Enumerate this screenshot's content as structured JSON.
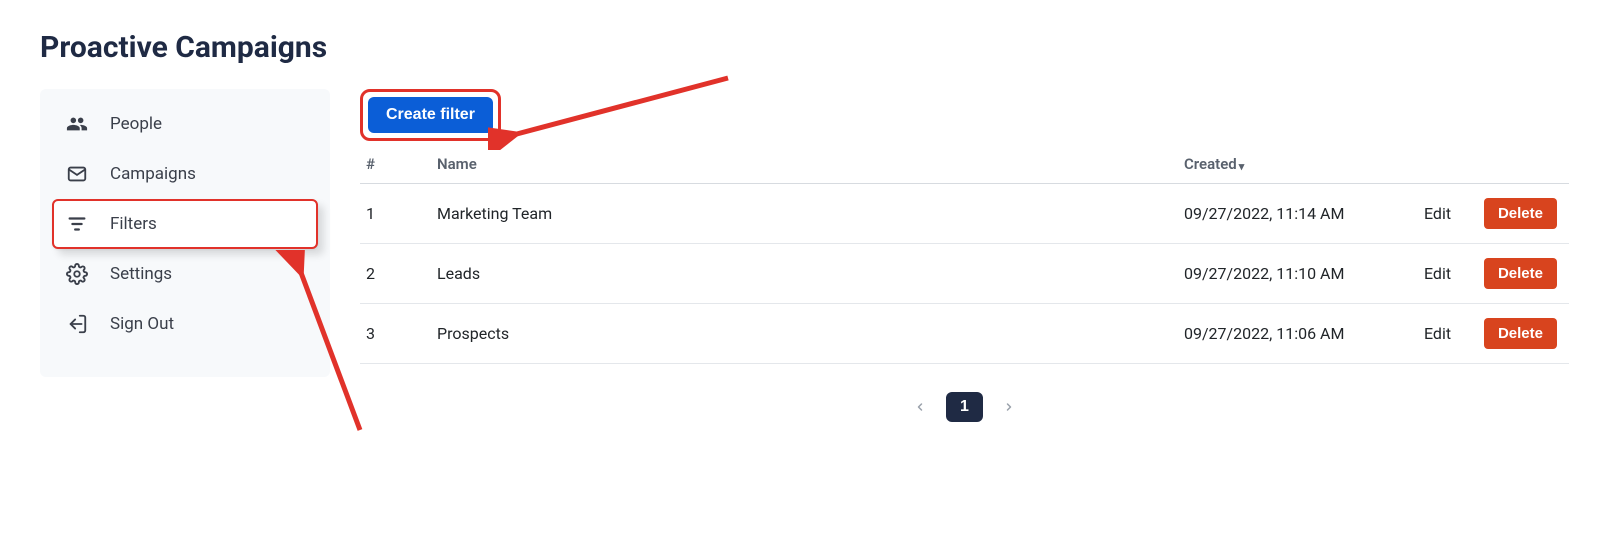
{
  "page_title": "Proactive Campaigns",
  "sidebar": {
    "items": [
      {
        "label": "People"
      },
      {
        "label": "Campaigns"
      },
      {
        "label": "Filters"
      },
      {
        "label": "Settings"
      },
      {
        "label": "Sign Out"
      }
    ],
    "active_index": 2
  },
  "toolbar": {
    "create_filter_label": "Create filter"
  },
  "table": {
    "headers": {
      "index": "#",
      "name": "Name",
      "created": "Created",
      "edit": "",
      "delete": ""
    },
    "sort": {
      "column": "created",
      "direction": "desc"
    },
    "rows": [
      {
        "index": "1",
        "name": "Marketing Team",
        "created": "09/27/2022, 11:14 AM"
      },
      {
        "index": "2",
        "name": "Leads",
        "created": "09/27/2022, 11:10 AM"
      },
      {
        "index": "3",
        "name": "Prospects",
        "created": "09/27/2022, 11:06 AM"
      }
    ],
    "edit_label": "Edit",
    "delete_label": "Delete"
  },
  "pagination": {
    "current": "1"
  },
  "colors": {
    "accent_red": "#e1322a",
    "primary_blue": "#0b5ed7",
    "danger_orange": "#d8441e",
    "dark_navy": "#1f2a44"
  }
}
